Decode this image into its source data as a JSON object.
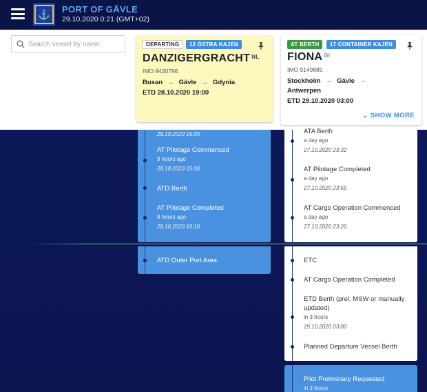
{
  "header": {
    "title": "PORT OF GÄVLE",
    "datetime": "29.10.2020 0:21 (GMT+02)",
    "logo_icon": "anchor-crest-icon",
    "colors": {
      "bar": "#0a1446",
      "title": "#5aa6f2",
      "logo": "#f1c232"
    }
  },
  "search": {
    "placeholder": "Search vessel by name"
  },
  "vessels": [
    {
      "status": "DEPARTING",
      "quay": "12 ÖSTRA KAJEN",
      "name": "DANZIGERGRACHT",
      "flag": "NL",
      "imo": "IMO 9420796",
      "route": [
        "Busan",
        "Gävle",
        "Gdynia"
      ],
      "etd": "ETD 28.10.2020 19:00",
      "color": "#fcf8be"
    },
    {
      "status": "AT BERTH",
      "quay": "17 CONTAINER KAJEN",
      "name": "FIONA",
      "flag": "GI",
      "imo": "IMO 9149885",
      "route": [
        "Stockholm",
        "Gävle",
        "Antwerpen"
      ],
      "etd": "ETD 29.10.2020 03:00",
      "show_more": "SHOW MORE",
      "color": "#ffffff"
    }
  ],
  "timeline_left_past": [
    {
      "title": "",
      "ago": "",
      "date": "28.10.2020 15:00"
    },
    {
      "title": "AT Pilotage Commenced",
      "ago": "9 hours ago",
      "date": "28.10.2020 15:00"
    },
    {
      "title": "ATD Berth",
      "ago": "",
      "date": ""
    },
    {
      "title": "AT Pilotage Completed",
      "ago": "8 hours ago",
      "date": "28.10.2020 16:10"
    }
  ],
  "timeline_left_future": [
    {
      "title": "ATD Outer Port Area"
    }
  ],
  "timeline_right_past": [
    {
      "title": "ATA Berth",
      "ago": "a day ago",
      "date": "27.10.2020 23:32"
    },
    {
      "title": "AT Pilotage Completed",
      "ago": "a day ago",
      "date": "27.10.2020 23:55"
    },
    {
      "title": "AT Cargo Operation Commenced",
      "ago": "a day ago",
      "date": "27.10.2020 23:26"
    }
  ],
  "timeline_right_future": [
    {
      "title": "ETC"
    },
    {
      "title": "AT Cargo Operation Completed"
    },
    {
      "title": "ETD Berth (prel. MSW or manually",
      "title2": "updated)",
      "ago": "in 3 hours",
      "date": "29.10.2020 03:00"
    },
    {
      "title": "Planned Departure Vessel Berth"
    }
  ],
  "timeline_right_upcoming": [
    {
      "title": "Pilot Preliminary Requested",
      "ago": "in 3 hours"
    }
  ],
  "colors": {
    "panel_blue": "#4a92e0",
    "now_line": "#79d47a",
    "quay_badge": "#3b8de0",
    "berth_badge": "#3a9a3f"
  }
}
